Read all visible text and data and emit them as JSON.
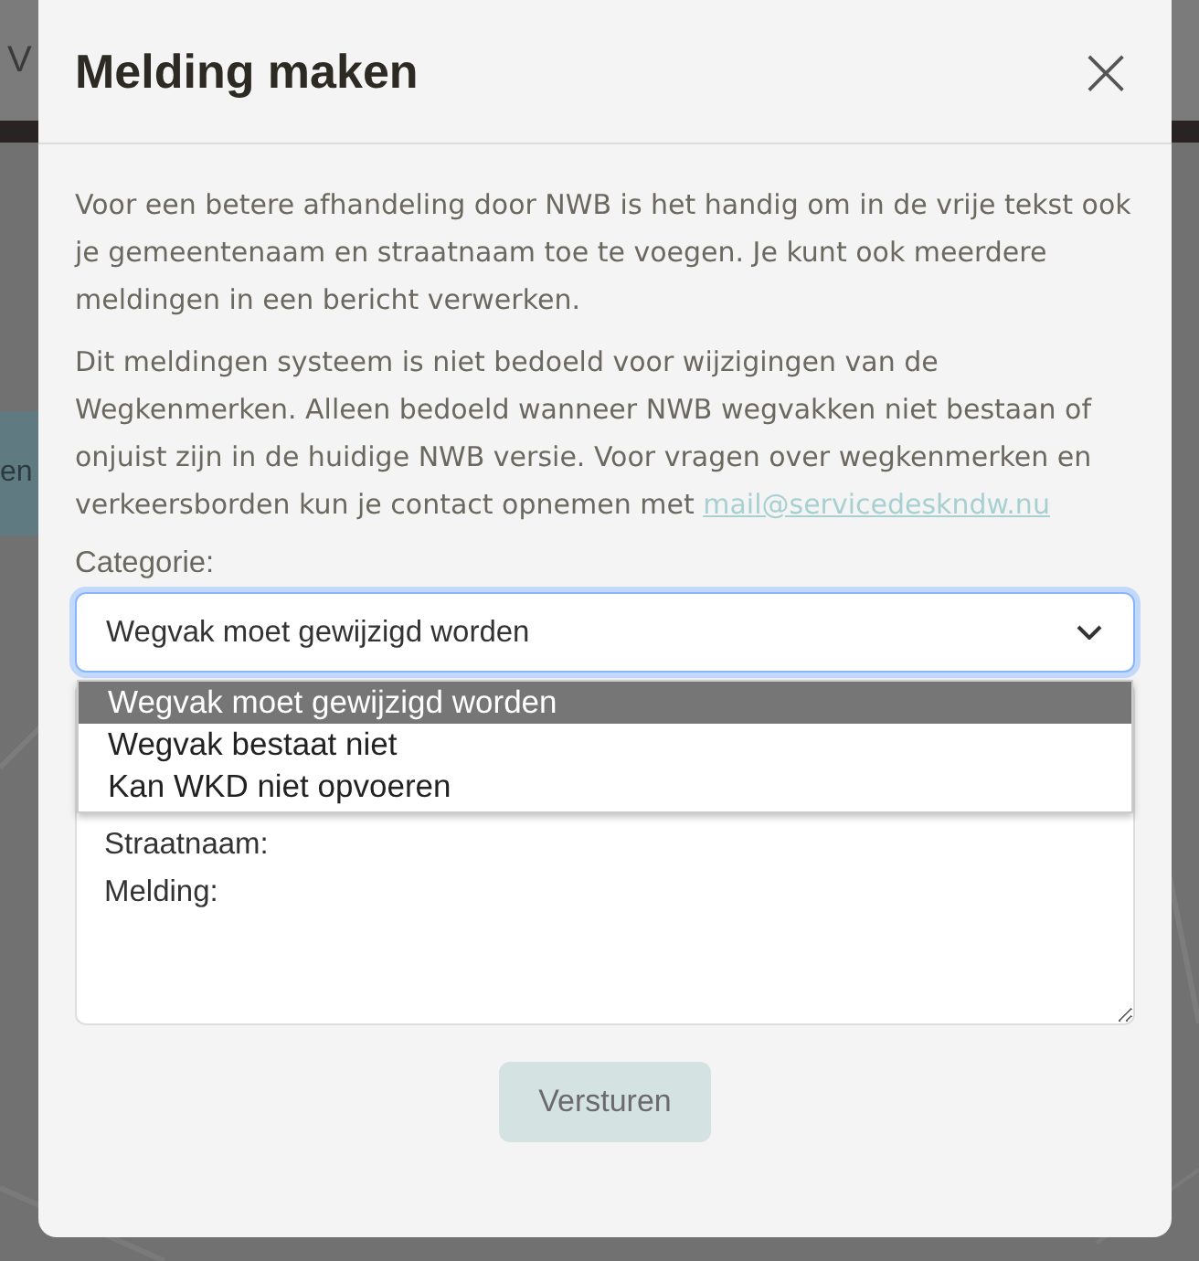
{
  "background": {
    "header_text": "V",
    "banner_text": "en"
  },
  "dialog": {
    "title": "Melding maken",
    "close": "×",
    "paragraphs": [
      "Voor een betere afhandeling door NWB is het handig om in de vrije tekst ook je gemeentenaam en straatnaam toe te voegen. Je kunt ook meerdere meldingen in een bericht verwerken.",
      "Dit meldingen systeem is niet bedoeld voor wijzigingen van de Wegkenmerken. Alleen bedoeld wanneer NWB wegvakken niet bestaan of onjuist zijn in de huidige NWB versie. Voor vragen over wegkenmerken en verkeersborden kun je contact opnemen met"
    ],
    "email_link": "mail@servicedeskndw.nu",
    "category": {
      "label": "Categorie:",
      "value": "Wegvak moet gewijzigd worden",
      "expanded": true,
      "options": [
        {
          "label": "Wegvak moet gewijzigd worden",
          "selected": true
        },
        {
          "label": "Wegvak bestaat niet",
          "selected": false
        },
        {
          "label": "Kan WKD niet opvoeren",
          "selected": false
        }
      ]
    },
    "message": {
      "value": "Straatnaam:\nMelding:"
    },
    "submit": {
      "label": "Versturen",
      "disabled": true
    }
  }
}
